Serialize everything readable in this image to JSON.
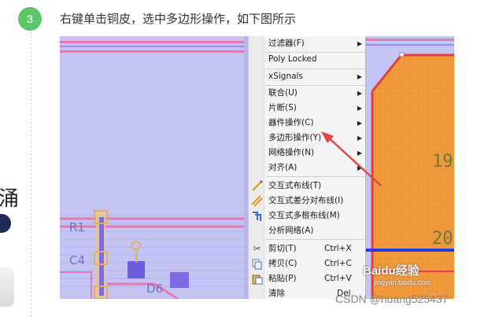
{
  "step": {
    "number": "3",
    "text": "右键单击铜皮，选中多边形操作，如下图所示"
  },
  "left_fragment": {
    "glyph": "涌"
  },
  "menu": {
    "items": [
      {
        "label": "过滤器(F)",
        "submenu": true
      },
      {
        "label": "Poly Locked",
        "submenu": false
      },
      {
        "label": "xSignals",
        "submenu": true
      },
      {
        "label": "联合(U)",
        "submenu": true
      },
      {
        "label": "片断(S)",
        "submenu": true
      },
      {
        "label": "器件操作(C)",
        "submenu": true
      },
      {
        "label": "多边形操作(Y)",
        "submenu": true
      },
      {
        "label": "网络操作(N)",
        "submenu": true
      },
      {
        "label": "对齐(A)",
        "submenu": true
      },
      {
        "label": "交互式布线(T)",
        "icon": "route-icon"
      },
      {
        "label": "交互式差分对布线(I)",
        "icon": "diff-pair-route-icon"
      },
      {
        "label": "交互式多根布线(M)",
        "icon": "multi-route-icon"
      },
      {
        "label": "分析网络(A)"
      },
      {
        "label": "剪切(T)",
        "shortcut": "Ctrl+X",
        "icon": "scissors-icon"
      },
      {
        "label": "拷贝(C)",
        "shortcut": "Ctrl+C",
        "icon": "copy-icon"
      },
      {
        "label": "粘贴(P)",
        "shortcut": "Ctrl+V",
        "icon": "paste-icon"
      },
      {
        "label": "清除",
        "shortcut": "Del"
      }
    ]
  },
  "pcb": {
    "designators": [
      "R1",
      "C4",
      "D6"
    ],
    "copper_labels": [
      "19",
      "20"
    ]
  },
  "watermarks": {
    "baidu": "Baidu经验",
    "baidu_url": "jingyan.baidu.com",
    "csdn": "CSDN @huang525437"
  },
  "colors": {
    "step_green": "#5cc56a",
    "pcb_background": "#c4c4f4",
    "copper_orange": "#f09a3c",
    "annotation_red": "#e04848",
    "trace_blue": "#2b3ae0"
  }
}
